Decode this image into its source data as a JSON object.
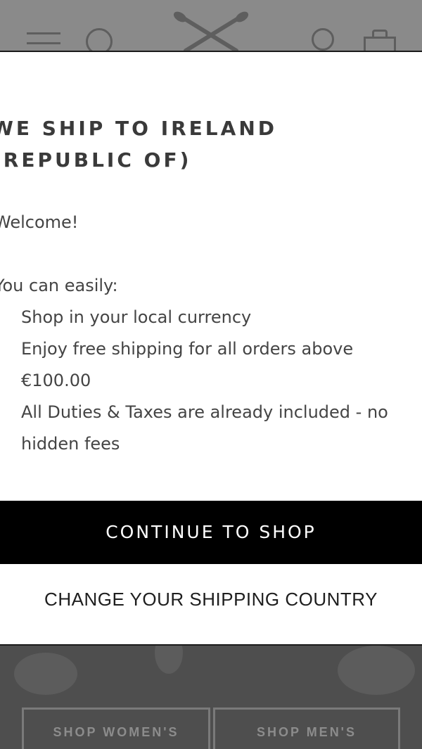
{
  "modal": {
    "title": "WE SHIP TO IRELAND (REPUBLIC OF)",
    "greeting": "Welcome!",
    "intro": "You can easily:",
    "benefits": [
      "Shop in your local currency",
      "Enjoy free shipping for all orders above €100.00",
      "All Duties & Taxes are already included - no hidden fees"
    ],
    "continue_label": "CONTINUE TO SHOP",
    "change_country_label": "CHANGE YOUR SHIPPING COUNTRY"
  },
  "background": {
    "shop_women_label": "SHOP WOMEN'S",
    "shop_men_label": "SHOP MEN'S"
  },
  "colors": {
    "overlay": "#7f7f7f",
    "modal_bg": "#ffffff",
    "primary_button": "#000000",
    "primary_button_text": "#ffffff",
    "text": "#444444"
  },
  "icons": {
    "menu": "hamburger-menu-icon",
    "search": "search-icon",
    "logo": "crossed-oars-logo",
    "account": "user-icon",
    "bag": "shopping-bag-icon"
  }
}
